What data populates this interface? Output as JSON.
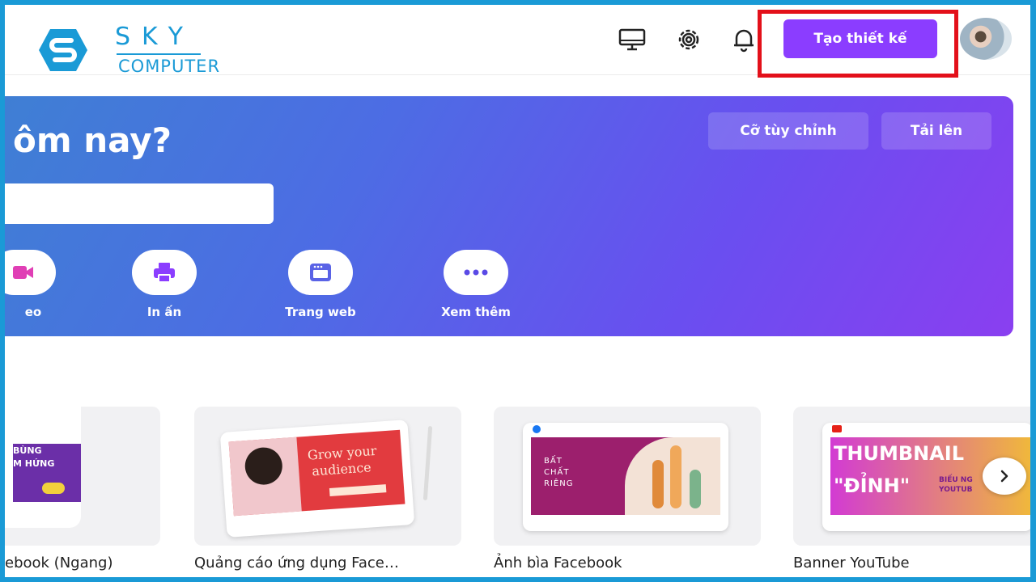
{
  "logo": {
    "sky": "SKY",
    "computer": "COMPUTER"
  },
  "header": {
    "create_button": "Tạo thiết kế",
    "icons": [
      "monitor-icon",
      "gear-icon",
      "bell-icon"
    ]
  },
  "hero": {
    "title": "ôm nay?",
    "custom_size_button": "Cỡ tùy chỉnh",
    "upload_button": "Tải lên",
    "categories": [
      {
        "label": "eo",
        "icon": "video-icon"
      },
      {
        "label": "In ấn",
        "icon": "printer-icon"
      },
      {
        "label": "Trang web",
        "icon": "browser-icon"
      },
      {
        "label": "Xem thêm",
        "icon": "more-icon"
      }
    ]
  },
  "templates": [
    {
      "label": "ebook (Ngang)",
      "thumb_text": [
        "BÙNG",
        "M HỨNG"
      ]
    },
    {
      "label": "Quảng cáo ứng dụng Face…",
      "thumb_text": [
        "Grow your",
        "audience"
      ]
    },
    {
      "label": "Ảnh bìa Facebook",
      "thumb_text": [
        "BẤT",
        "CHẤT",
        "RIÊNG"
      ]
    },
    {
      "label": "Banner YouTube",
      "thumb_text": [
        "THUMBNAIL",
        "\"ĐỈNH\"",
        "BIẾU NG",
        "YOUTUB"
      ]
    }
  ],
  "colors": {
    "accent": "#8b3dff",
    "frame": "#1a9ad6",
    "highlight": "#e3101a"
  }
}
